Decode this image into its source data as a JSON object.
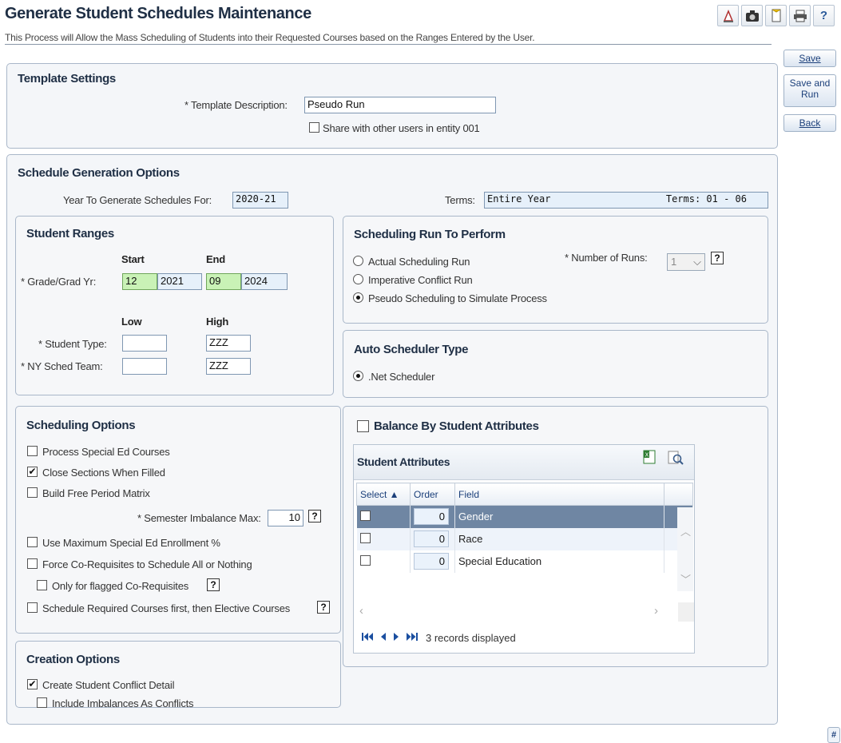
{
  "page": {
    "title": "Generate Student Schedules Maintenance",
    "subtitle": "This Process will Allow the Mass Scheduling of Students into their Requested Courses based on the Ranges Entered by the User."
  },
  "toolbar": {
    "icons": [
      "report-icon",
      "camera-icon",
      "bookmark-icon",
      "print-icon",
      "help-icon"
    ],
    "help_label": "?"
  },
  "side_buttons": {
    "save": "Save",
    "save_and_run_line1": "Save and",
    "save_and_run_line2": "Run",
    "back": "Back"
  },
  "template_settings": {
    "title": "Template Settings",
    "description_label": "* Template Description:",
    "description_value": "Pseudo Run",
    "share_label": "Share with other users in entity 001",
    "share_checked": false
  },
  "schedule_options": {
    "title": "Schedule Generation Options",
    "year_label": "Year To Generate Schedules For:",
    "year_value": "2020-21",
    "terms_label": "Terms:",
    "terms_value": "Entire Year",
    "terms_range": "Terms: 01 - 06"
  },
  "student_ranges": {
    "title": "Student Ranges",
    "start_header": "Start",
    "end_header": "End",
    "grade_label": "* Grade/Grad Yr:",
    "grade_start": "12",
    "grad_yr_start": "2021",
    "grade_end": "09",
    "grad_yr_end": "2024",
    "low_header": "Low",
    "high_header": "High",
    "student_type_label": "* Student Type:",
    "student_type_low": "",
    "student_type_high": "ZZZ",
    "sched_team_label": "* NY Sched Team:",
    "sched_team_low": "",
    "sched_team_high": "ZZZ"
  },
  "run_to_perform": {
    "title": "Scheduling Run To Perform",
    "options": [
      "Actual Scheduling Run",
      "Imperative Conflict Run",
      "Pseudo Scheduling to Simulate Process"
    ],
    "selected_index": 2,
    "num_runs_label": "* Number of Runs:",
    "num_runs_value": "1",
    "help": "?"
  },
  "auto_scheduler": {
    "title": "Auto Scheduler Type",
    "option": ".Net Scheduler"
  },
  "scheduling_options": {
    "title": "Scheduling Options",
    "process_special_ed": "Process Special Ed Courses",
    "close_sections": "Close Sections When Filled",
    "build_free_period": "Build Free Period Matrix",
    "semester_imbalance_label": "* Semester Imbalance Max:",
    "semester_imbalance_value": "10",
    "use_max_special_ed": "Use Maximum Special Ed Enrollment %",
    "force_coreq": "Force Co-Requisites to Schedule All or Nothing",
    "only_flagged": "Only for flagged Co-Requisites",
    "schedule_required_first": "Schedule Required Courses first, then Elective Courses",
    "checked_mark": "✔",
    "help": "?"
  },
  "creation_options": {
    "title": "Creation Options",
    "create_conflict_detail": "Create Student Conflict Detail",
    "include_imbalances": "Include Imbalances As Conflicts",
    "checked_mark": "✔"
  },
  "balance": {
    "label": "Balance By Student Attributes",
    "grid_title": "Student Attributes",
    "columns": [
      "Select ▲",
      "Order",
      "Field"
    ],
    "rows": [
      {
        "order": "0",
        "field": "Gender"
      },
      {
        "order": "0",
        "field": "Race"
      },
      {
        "order": "0",
        "field": "Special Education"
      }
    ],
    "records": "3 records displayed",
    "nav_icons": [
      "first-page-icon",
      "prev-page-icon",
      "next-page-icon",
      "last-page-icon"
    ]
  },
  "corner_badge": "#",
  "colors": {
    "title": "#1f2f45",
    "link": "#1b3f7a",
    "selected_row": "#6f86a3",
    "green_input": "#c9f2b6"
  }
}
